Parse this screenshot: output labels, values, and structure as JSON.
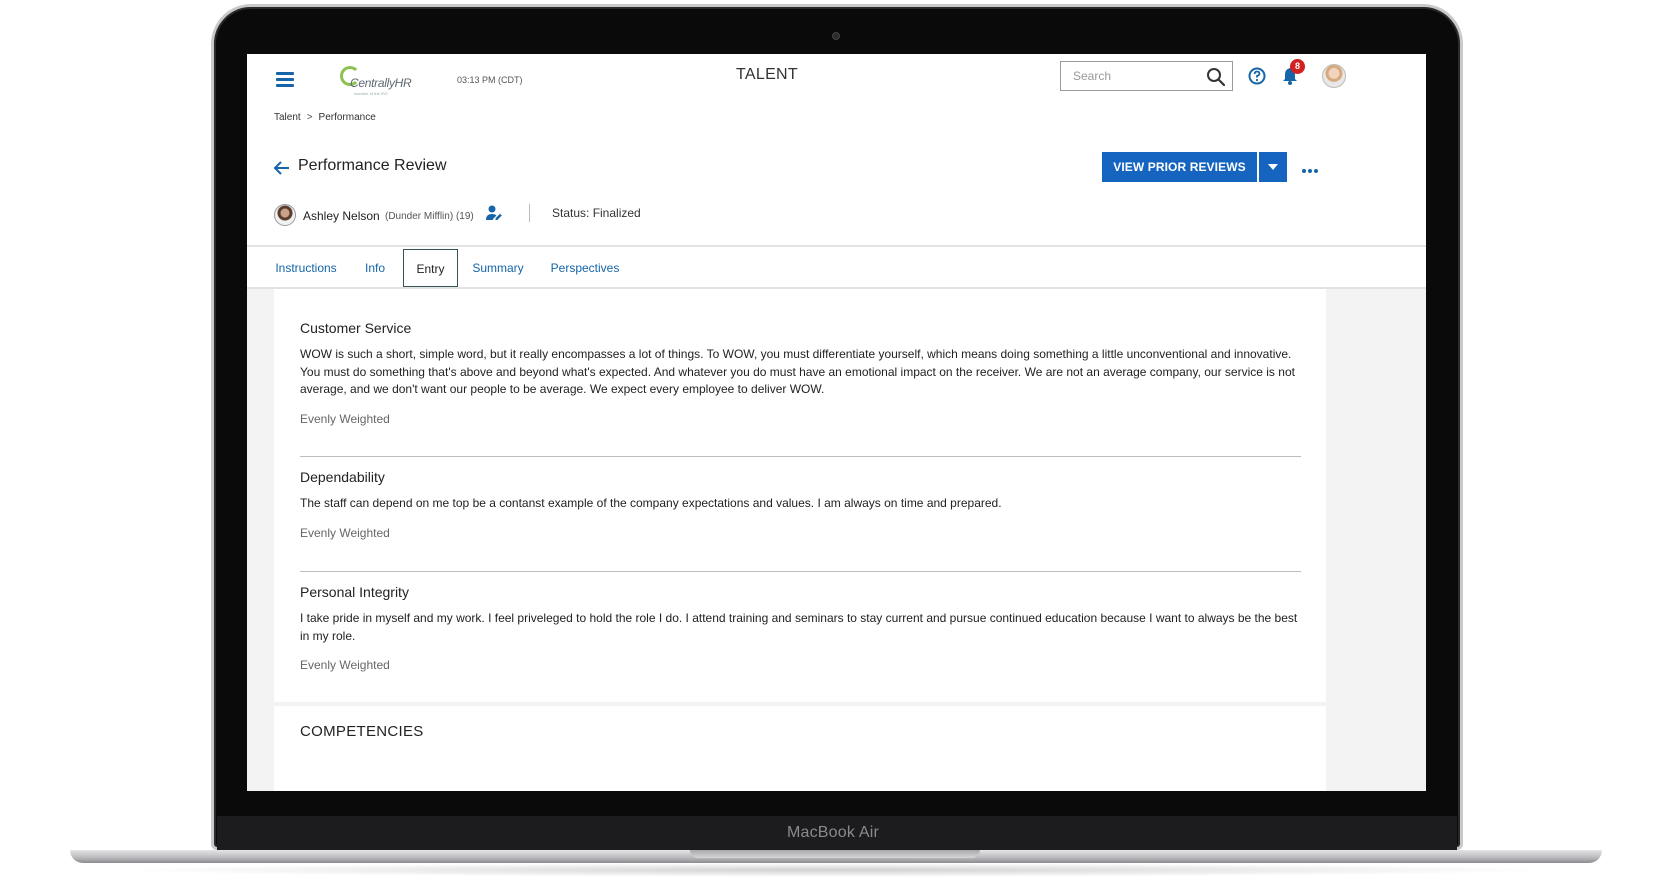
{
  "device": {
    "label": "MacBook Air"
  },
  "header": {
    "logo_text": "CentrallyHR",
    "logo_sub": "member of the ISG",
    "clock": "03:13 PM (CDT)",
    "app_title": "TALENT",
    "search_placeholder": "Search",
    "notifications_count": "8"
  },
  "breadcrumb": {
    "items": [
      "Talent",
      "Performance"
    ],
    "separator": ">"
  },
  "page": {
    "title": "Performance Review",
    "primary_button": "VIEW PRIOR REVIEWS"
  },
  "employee": {
    "name": "Ashley Nelson",
    "org": "(Dunder Mifflin) (19)",
    "status": "Status: Finalized"
  },
  "tabs": [
    {
      "label": "Instructions",
      "active": false
    },
    {
      "label": "Info",
      "active": false
    },
    {
      "label": "Entry",
      "active": true
    },
    {
      "label": "Summary",
      "active": false
    },
    {
      "label": "Perspectives",
      "active": false
    }
  ],
  "sections": [
    {
      "title": "Customer Service",
      "body": "WOW is such a short, simple word, but it really encompasses a lot of things. To WOW, you must differentiate yourself, which means doing something a little unconventional and innovative. You must do something that's above and beyond what's expected. And whatever you do must have an emotional impact on the receiver. We are not an average company, our service is not average, and we don't want our people to be average. We expect every employee to deliver WOW.",
      "weight": "Evenly Weighted"
    },
    {
      "title": "Dependability",
      "body": "The staff can depend on me top be a contanst example of the company expectations and values. I am always on time and prepared.",
      "weight": "Evenly Weighted"
    },
    {
      "title": "Personal Integrity",
      "body": "I take pride in myself and my work. I feel priveleged to hold the role I do. I attend training and seminars to stay current and pursue continued education because I want to always be the best in my role.",
      "weight": "Evenly Weighted"
    }
  ],
  "competencies": {
    "title": "COMPETENCIES"
  },
  "colors": {
    "accent": "#1565c0",
    "link": "#1565a8",
    "badge": "#d21f1f",
    "logo_green": "#8cc04f"
  }
}
